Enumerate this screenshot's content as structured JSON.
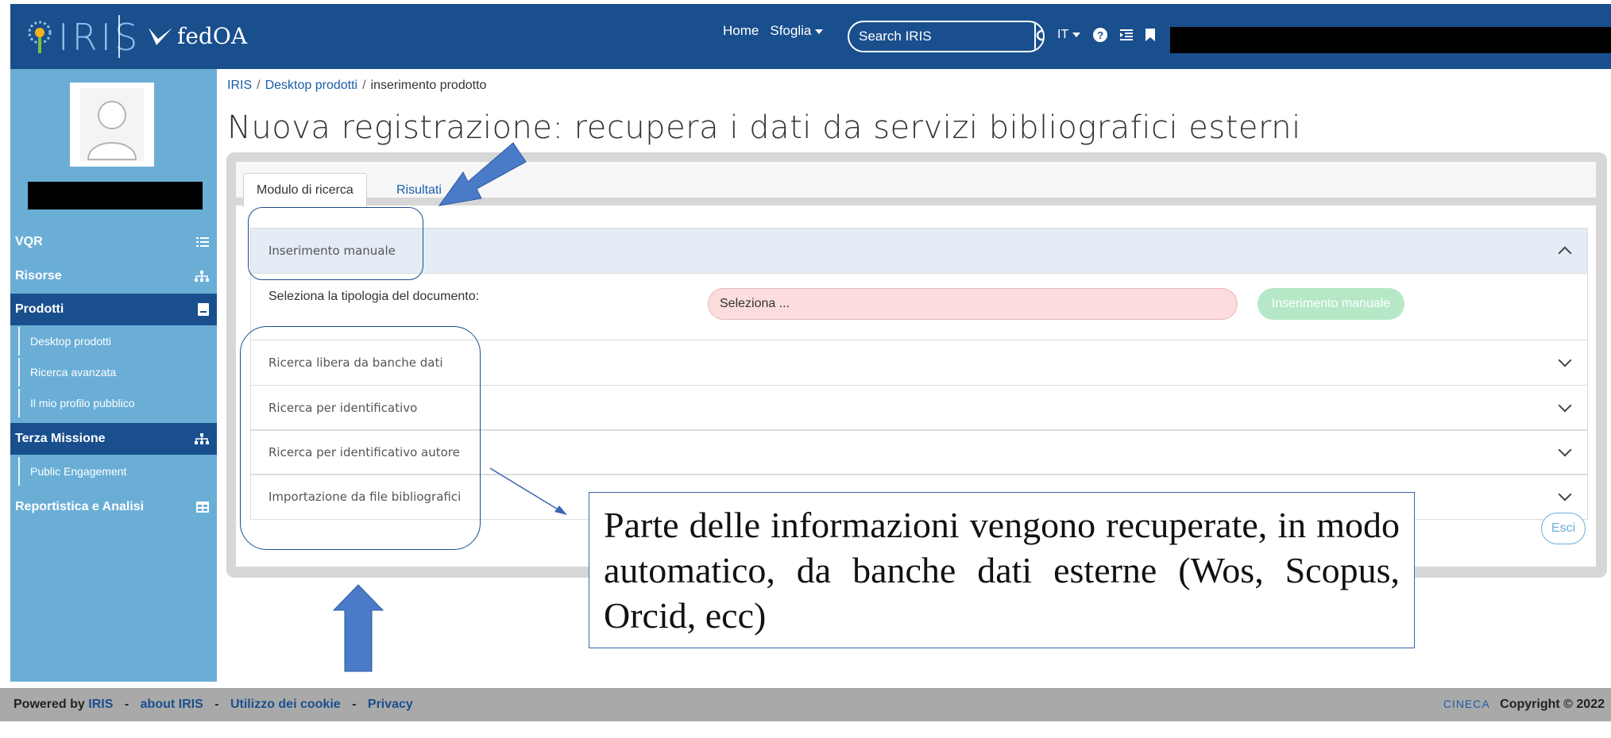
{
  "header": {
    "logo_text": "IRIS",
    "logo2_text": "fedOA",
    "nav": {
      "home": "Home",
      "browse": "Sfoglia"
    },
    "search": {
      "placeholder": "Search IRIS"
    },
    "language": "IT"
  },
  "sidebar": {
    "items": [
      {
        "label": "VQR",
        "icon": "list-ordered-icon"
      },
      {
        "label": "Risorse",
        "icon": "sitemap-icon"
      },
      {
        "label": "Prodotti",
        "icon": "book-icon",
        "active": true
      },
      {
        "label": "Terza Missione",
        "icon": "sitemap-icon"
      },
      {
        "label": "Reportistica e Analisi",
        "icon": "table-icon"
      }
    ],
    "prodotti_sub": [
      "Desktop prodotti",
      "Ricerca avanzata",
      "Il mio profilo pubblico"
    ],
    "terza_sub": [
      "Public Engagement"
    ]
  },
  "breadcrumb": {
    "root": "IRIS",
    "section": "Desktop prodotti",
    "current": "inserimento prodotto"
  },
  "page_title": "Nuova registrazione: recupera i dati da servizi bibliografici esterni",
  "tabs": [
    "Modulo di ricerca",
    "Risultati"
  ],
  "accordion": {
    "manual": {
      "title": "Inserimento manuale",
      "doc_label": "Seleziona la tipologia del documento:",
      "select_value": "Seleziona ...",
      "button": "Inserimento manuale"
    },
    "others": [
      "Ricerca libera da banche dati",
      "Ricerca per identificativo",
      "Ricerca per identificativo autore",
      "Importazione da file bibliografici"
    ]
  },
  "exit_button": "Esci",
  "callout": "Parte delle informazioni vengono recuperate, in modo automatico, da banche dati esterne (Wos, Scopus, Orcid, ecc)",
  "footer": {
    "powered_by": "Powered by",
    "links": [
      "IRIS",
      "about IRIS",
      "Utilizzo dei cookie",
      "Privacy"
    ],
    "brand": "CINECA",
    "copyright": "Copyright © 2022"
  },
  "colors": {
    "header": "#1a4f8e",
    "sidebar": "#6aaed6",
    "active": "#1a4f8e",
    "select_bg": "#fcdcdc",
    "button_green": "#b6e8c7"
  }
}
